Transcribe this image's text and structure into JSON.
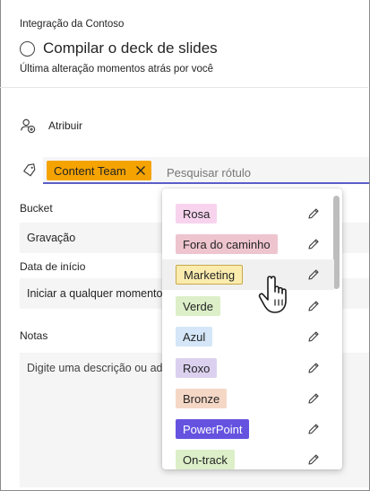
{
  "header": {
    "app_title": "Integração da Contoso",
    "task_title": "Compilar o deck de slides",
    "last_modified": "Última alteração momentos atrás por você"
  },
  "assign": {
    "label": "Atribuir"
  },
  "labels": {
    "selected_chip": "Content Team",
    "search_placeholder": "Pesquisar rótulo"
  },
  "bucket": {
    "label": "Bucket",
    "value": "Gravação"
  },
  "start_date": {
    "label": "Data de início",
    "value": "Iniciar a qualquer momento"
  },
  "notes": {
    "label": "Notas",
    "placeholder": "Digite uma descrição ou adicione notas aqui"
  },
  "dropdown": {
    "options": [
      {
        "label": "Rosa",
        "color": "#f7d3ee"
      },
      {
        "label": "Fora do caminho",
        "color": "#eec5cf"
      },
      {
        "label": "Marketing",
        "color": "#fbecae",
        "border": "#c7a94b",
        "hover": true
      },
      {
        "label": "Verde",
        "color": "#dcefc8"
      },
      {
        "label": "Azul",
        "color": "#d4e6f7"
      },
      {
        "label": "Roxo",
        "color": "#dbd1ef"
      },
      {
        "label": "Bronze",
        "color": "#f5d7c6"
      },
      {
        "label": "PowerPoint",
        "color": "#6553e0",
        "text_color": "#ffffff"
      },
      {
        "label": "On-track",
        "color": "#dcefc8"
      }
    ]
  },
  "icons": {
    "assign": "add-person-icon",
    "tag": "tag-icon",
    "chip_close": "close-icon",
    "edit": "pencil-icon",
    "cursor": "hand-pointer-icon"
  }
}
